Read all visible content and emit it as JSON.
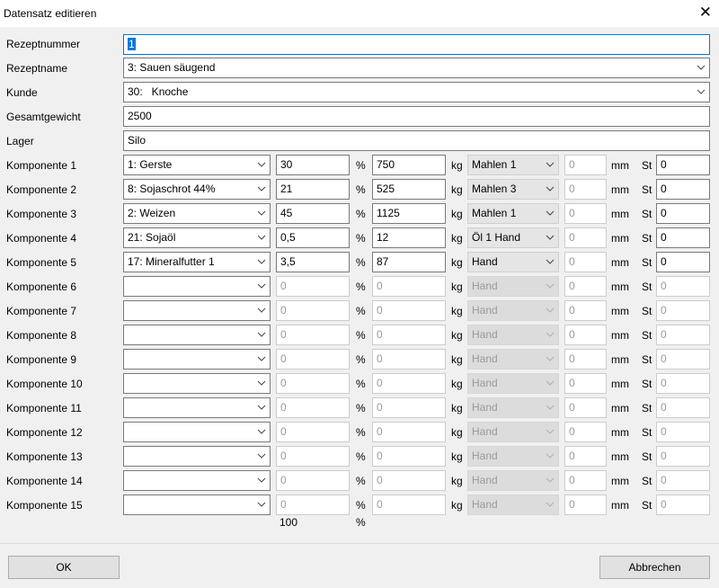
{
  "window": {
    "title": "Datensatz editieren"
  },
  "header_fields": {
    "rezeptnummer": {
      "label": "Rezeptnummer",
      "value": "1"
    },
    "rezeptname": {
      "label": "Rezeptname",
      "value": "3: Sauen säugend"
    },
    "kunde": {
      "label": "Kunde",
      "value": "30:   Knoche"
    },
    "gesamtgewicht": {
      "label": "Gesamtgewicht",
      "value": "2500"
    },
    "lager": {
      "label": "Lager",
      "value": "Silo"
    }
  },
  "units": {
    "percent": "%",
    "kg": "kg",
    "mm": "mm",
    "st": "St"
  },
  "components": [
    {
      "label": "Komponente 1",
      "name": "1: Gerste",
      "percent": "30",
      "kg": "750",
      "process": "Mahlen 1",
      "mm": "0",
      "st": "0",
      "enabled": true
    },
    {
      "label": "Komponente 2",
      "name": "8: Sojaschrot 44%",
      "percent": "21",
      "kg": "525",
      "process": "Mahlen 3",
      "mm": "0",
      "st": "0",
      "enabled": true
    },
    {
      "label": "Komponente 3",
      "name": "2: Weizen",
      "percent": "45",
      "kg": "1125",
      "process": "Mahlen 1",
      "mm": "0",
      "st": "0",
      "enabled": true
    },
    {
      "label": "Komponente 4",
      "name": "21: Sojaöl",
      "percent": "0,5",
      "kg": "12",
      "process": "Öl 1 Hand",
      "mm": "0",
      "st": "0",
      "enabled": true
    },
    {
      "label": "Komponente 5",
      "name": "17: Mineralfutter 1",
      "percent": "3,5",
      "kg": "87",
      "process": "Hand",
      "mm": "0",
      "st": "0",
      "enabled": true
    },
    {
      "label": "Komponente 6",
      "name": "",
      "percent": "0",
      "kg": "0",
      "process": "Hand",
      "mm": "0",
      "st": "0",
      "enabled": false
    },
    {
      "label": "Komponente 7",
      "name": "",
      "percent": "0",
      "kg": "0",
      "process": "Hand",
      "mm": "0",
      "st": "0",
      "enabled": false
    },
    {
      "label": "Komponente 8",
      "name": "",
      "percent": "0",
      "kg": "0",
      "process": "Hand",
      "mm": "0",
      "st": "0",
      "enabled": false
    },
    {
      "label": "Komponente 9",
      "name": "",
      "percent": "0",
      "kg": "0",
      "process": "Hand",
      "mm": "0",
      "st": "0",
      "enabled": false
    },
    {
      "label": "Komponente 10",
      "name": "",
      "percent": "0",
      "kg": "0",
      "process": "Hand",
      "mm": "0",
      "st": "0",
      "enabled": false
    },
    {
      "label": "Komponente 11",
      "name": "",
      "percent": "0",
      "kg": "0",
      "process": "Hand",
      "mm": "0",
      "st": "0",
      "enabled": false
    },
    {
      "label": "Komponente 12",
      "name": "",
      "percent": "0",
      "kg": "0",
      "process": "Hand",
      "mm": "0",
      "st": "0",
      "enabled": false
    },
    {
      "label": "Komponente 13",
      "name": "",
      "percent": "0",
      "kg": "0",
      "process": "Hand",
      "mm": "0",
      "st": "0",
      "enabled": false
    },
    {
      "label": "Komponente 14",
      "name": "",
      "percent": "0",
      "kg": "0",
      "process": "Hand",
      "mm": "0",
      "st": "0",
      "enabled": false
    },
    {
      "label": "Komponente 15",
      "name": "",
      "percent": "0",
      "kg": "0",
      "process": "Hand",
      "mm": "0",
      "st": "0",
      "enabled": false
    }
  ],
  "totals": {
    "percent_sum": "100",
    "percent_unit": "%"
  },
  "buttons": {
    "ok": "OK",
    "cancel": "Abbrechen"
  },
  "icons": {
    "close": "close-icon",
    "dropdown": "chevron-down-icon"
  },
  "colors": {
    "focus": "#0078d7",
    "dialog_bg": "#f0f0f0",
    "border": "#7a7a7a"
  }
}
